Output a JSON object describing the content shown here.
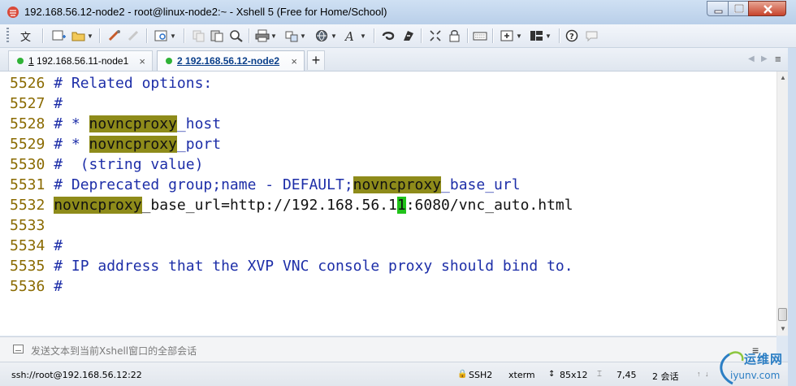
{
  "window": {
    "title": "192.168.56.12-node2 - root@linux-node2:~ - Xshell 5 (Free for Home/School)"
  },
  "toolbar": {
    "language_label": "文",
    "icons": [
      "new-session-icon",
      "open-folder-icon",
      "reconnect-icon",
      "disconnect-icon",
      "properties-icon",
      "copy-icon",
      "paste-icon",
      "find-icon",
      "print-icon",
      "transfer-icon",
      "globe-icon",
      "font-icon",
      "xftp-icon",
      "xmanager-icon",
      "fullscreen-icon",
      "lock-icon",
      "keyboard-icon",
      "add-pane-icon",
      "layout-icon",
      "help-icon",
      "chat-icon"
    ]
  },
  "tabs": [
    {
      "prefix": "1",
      "label": " 192.168.56.11-node1",
      "close": "×",
      "status_color": "#2fb236",
      "active": false
    },
    {
      "prefix": "2",
      "label": " 192.168.56.12-node2",
      "close": "×",
      "status_color": "#2fb236",
      "active": true
    }
  ],
  "tab_add_label": "+",
  "terminal": {
    "highlight_color": "#8e8b1a",
    "lines": [
      {
        "num": "5526",
        "segments": [
          {
            "t": " # Related options:",
            "c": "cm"
          }
        ]
      },
      {
        "num": "5527",
        "segments": [
          {
            "t": " #",
            "c": "cm"
          }
        ]
      },
      {
        "num": "5528",
        "segments": [
          {
            "t": " # * ",
            "c": "cm"
          },
          {
            "t": "novncproxy",
            "c": "hl"
          },
          {
            "t": "_host",
            "c": "cm"
          }
        ]
      },
      {
        "num": "5529",
        "segments": [
          {
            "t": " # * ",
            "c": "cm"
          },
          {
            "t": "novncproxy",
            "c": "hl"
          },
          {
            "t": "_port",
            "c": "cm"
          }
        ]
      },
      {
        "num": "5530",
        "segments": [
          {
            "t": " #  (string value)",
            "c": "cm"
          }
        ]
      },
      {
        "num": "5531",
        "segments": [
          {
            "t": " # Deprecated group;name - DEFAULT;",
            "c": "cm"
          },
          {
            "t": "novncproxy",
            "c": "hl"
          },
          {
            "t": "_base_url",
            "c": "cm"
          }
        ]
      },
      {
        "num": "5532",
        "segments": [
          {
            "t": " ",
            "c": "tx"
          },
          {
            "t": "novncproxy",
            "c": "hl"
          },
          {
            "t": "_base_url=http://192.168.56.1",
            "c": "tx"
          },
          {
            "t": "1",
            "c": "cur"
          },
          {
            "t": ":6080/vnc_auto.html",
            "c": "tx"
          }
        ]
      },
      {
        "num": "5533",
        "segments": []
      },
      {
        "num": "5534",
        "segments": [
          {
            "t": " #",
            "c": "cm"
          }
        ]
      },
      {
        "num": "5535",
        "segments": [
          {
            "t": " # IP address that the XVP VNC console proxy should bind to.",
            "c": "cm"
          }
        ]
      },
      {
        "num": "5536",
        "segments": [
          {
            "t": " #",
            "c": "cm"
          }
        ]
      }
    ]
  },
  "compose": {
    "text": "发送文本到当前Xshell窗口的全部会话"
  },
  "status": {
    "connection": "ssh://root@192.168.56.12:22",
    "protocol": "SSH2",
    "terminal_type": "xterm",
    "size": "85x12",
    "cursor_pos": "7,45",
    "sessions": "2 会话"
  },
  "watermark": {
    "cn": "运维网",
    "domain": "iyunv.com"
  }
}
